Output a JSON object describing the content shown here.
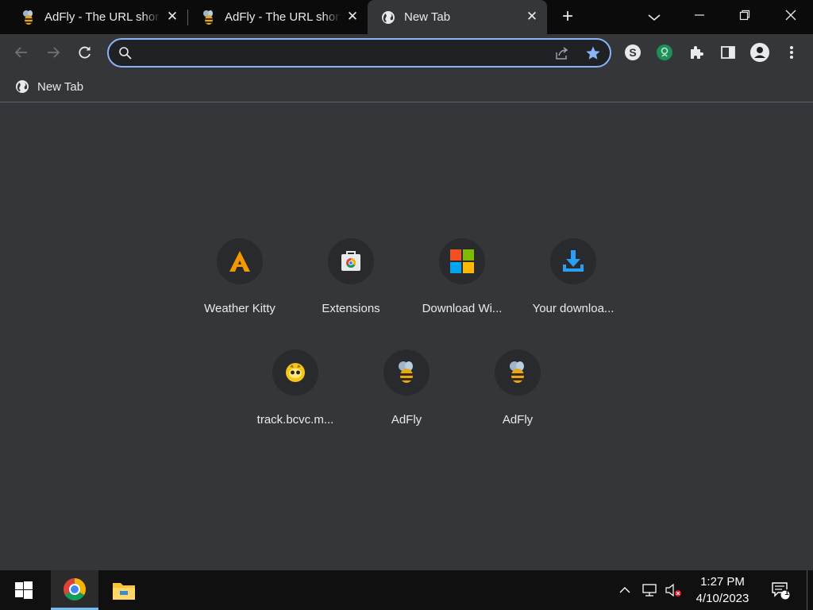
{
  "tabs": [
    {
      "title": "AdFly - The URL shortener",
      "close": "✕"
    },
    {
      "title": "AdFly - The URL shortener",
      "close": "✕"
    },
    {
      "title": "New Tab",
      "close": "✕"
    }
  ],
  "new_tab_button": "+",
  "omnibox": {
    "value": "",
    "placeholder": ""
  },
  "bookmarks": [
    {
      "label": "New Tab"
    }
  ],
  "shortcuts": [
    {
      "label": "Weather Kitty",
      "icon": "weather-kitty-icon"
    },
    {
      "label": "Extensions",
      "icon": "chrome-web-store-icon"
    },
    {
      "label": "Download Wi...",
      "icon": "windows-logo-icon"
    },
    {
      "label": "Your downloa...",
      "icon": "download-icon"
    },
    {
      "label": "track.bcvc.m...",
      "icon": "bcvc-icon"
    },
    {
      "label": "AdFly",
      "icon": "adfly-bee-icon"
    },
    {
      "label": "AdFly",
      "icon": "adfly-bee-icon"
    }
  ],
  "taskbar": {
    "time": "1:27 PM",
    "date": "4/10/2023",
    "notification_count": "1"
  },
  "colors": {
    "accent": "#8ab4f8",
    "star": "#8ab4f8",
    "background": "#35363a",
    "tabstrip": "#0b0b0c"
  }
}
